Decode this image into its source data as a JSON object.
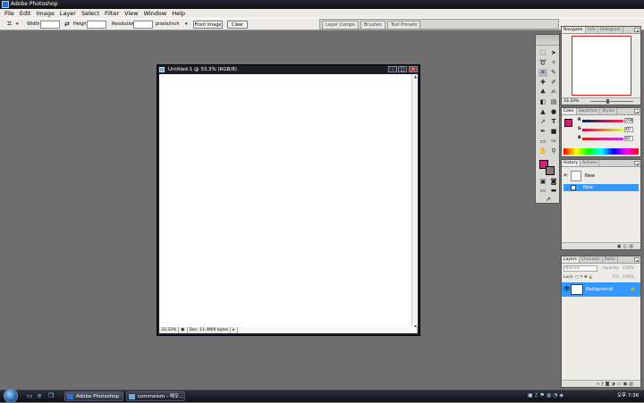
{
  "app": {
    "title": "Adobe Photoshop"
  },
  "menu": [
    "File",
    "Edit",
    "Image",
    "Layer",
    "Select",
    "Filter",
    "View",
    "Window",
    "Help"
  ],
  "options": {
    "width_label": "Width:",
    "height_label": "Height:",
    "resolution_label": "Resolution:",
    "units": "pixels/inch",
    "front_image": "Front Image",
    "clear": "Clear"
  },
  "wells": [
    "Layer Comps",
    "Brushes",
    "Tool Presets"
  ],
  "document": {
    "title": "Untitled-1 @ 33.3% (RGB/8)",
    "zoom": "33.33%",
    "status": "Doc: 11.4M/0 bytes"
  },
  "navigator": {
    "tabs": [
      "Navigator",
      "Info",
      "Histogram"
    ],
    "zoom": "33.33%"
  },
  "color": {
    "tabs": [
      "Color",
      "Swatches",
      "Styles"
    ],
    "channels": [
      {
        "label": "R",
        "value": "208",
        "color": "#d0207a"
      },
      {
        "label": "G",
        "value": "40",
        "color": "#d0207a"
      },
      {
        "label": "B",
        "value": "82",
        "color": "#d0207a"
      }
    ],
    "foreground": "#d0207a",
    "background": "#8a7a80"
  },
  "history": {
    "tabs": [
      "History",
      "Actions"
    ],
    "snapshot": "New",
    "items": [
      "New"
    ]
  },
  "layers": {
    "tabs": [
      "Layers",
      "Channels",
      "Paths"
    ],
    "blend_mode": "Normal",
    "opacity_label": "Opacity:",
    "opacity": "100%",
    "lock_label": "Lock:",
    "fill_label": "Fill:",
    "fill": "100%",
    "layer_name": "Background"
  },
  "taskbar": {
    "items": [
      "Adobe Photoshop",
      "commeism - 메모..."
    ],
    "clock": "오후 7:36",
    "colors": {
      "selection": "#3399ff",
      "accent": "#d0207a"
    }
  }
}
